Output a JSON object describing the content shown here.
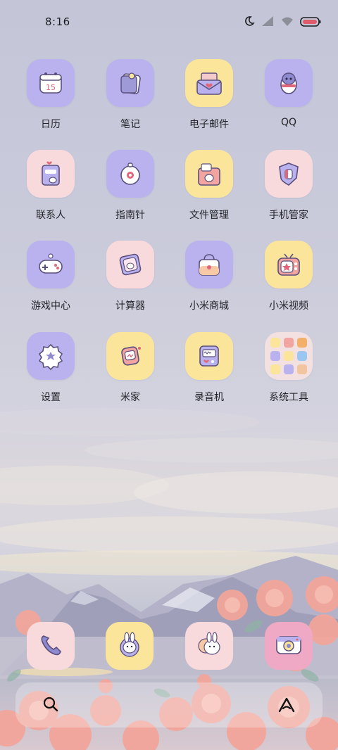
{
  "status_bar": {
    "time": "8:16",
    "icons": [
      "moon-icon",
      "signal-icon",
      "wifi-icon",
      "battery-icon"
    ]
  },
  "apps": [
    {
      "label": "日历",
      "icon": "calendar-icon",
      "badge_text": "15"
    },
    {
      "label": "笔记",
      "icon": "notes-icon"
    },
    {
      "label": "电子邮件",
      "icon": "email-icon"
    },
    {
      "label": "QQ",
      "icon": "qq-penguin-icon"
    },
    {
      "label": "联系人",
      "icon": "contacts-icon"
    },
    {
      "label": "指南针",
      "icon": "compass-icon"
    },
    {
      "label": "文件管理",
      "icon": "file-manager-icon"
    },
    {
      "label": "手机管家",
      "icon": "security-shield-icon"
    },
    {
      "label": "游戏中心",
      "icon": "game-controller-icon"
    },
    {
      "label": "计算器",
      "icon": "calculator-icon"
    },
    {
      "label": "小米商城",
      "icon": "shopping-bag-icon"
    },
    {
      "label": "小米视频",
      "icon": "tv-icon"
    },
    {
      "label": "设置",
      "icon": "gear-icon"
    },
    {
      "label": "米家",
      "icon": "home-robot-icon"
    },
    {
      "label": "录音机",
      "icon": "recorder-icon"
    },
    {
      "label": "系统工具",
      "icon": "folder-icon"
    }
  ],
  "dock": [
    {
      "icon": "phone-icon"
    },
    {
      "icon": "messages-bunny-icon"
    },
    {
      "icon": "browser-bunny-icon"
    },
    {
      "icon": "camera-icon"
    }
  ],
  "search_bar": {
    "left_icon": "search-icon",
    "right_icon": "assistant-icon"
  },
  "colors": {
    "tile_purple": "#b9b2ee",
    "tile_yellow": "#fbe59b",
    "tile_pink": "#f9dadc",
    "label_text": "#222228",
    "rose": "#f2a59a"
  }
}
